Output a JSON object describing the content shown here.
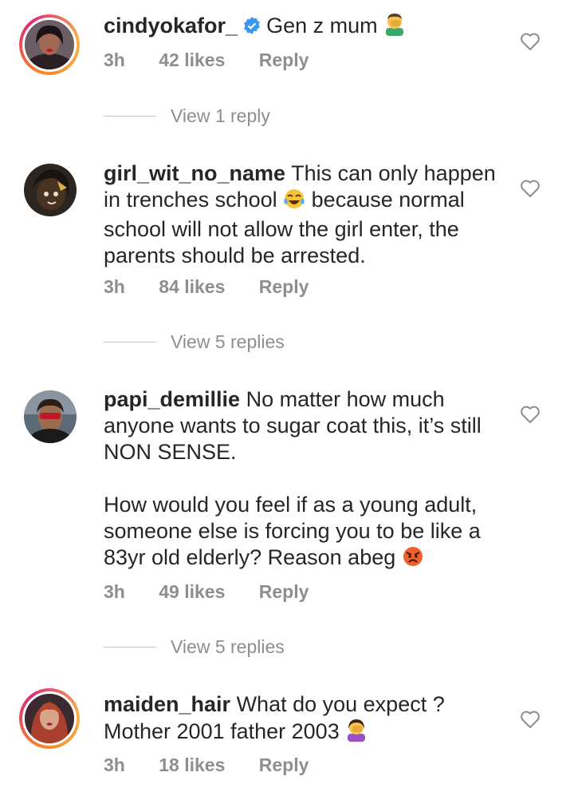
{
  "comments": [
    {
      "username": "cindyokafor_",
      "verified": true,
      "text": "Gen z mum",
      "time": "3h",
      "likes": "42 likes",
      "reply": "Reply",
      "view_replies": "View 1 reply",
      "emoji": "man-facepalming-emoji"
    },
    {
      "username": "girl_wit_no_name",
      "text_a": "This can only happen in trenches school",
      "text_b": "because normal school will not allow the girl enter, the parents should be arrested.",
      "time": "3h",
      "likes": "84 likes",
      "reply": "Reply",
      "view_replies": "View 5 replies",
      "emoji": "tears-of-joy-emoji"
    },
    {
      "username": "papi_demillie",
      "text_a": "No matter how much anyone wants to sugar coat this, it’s still NON SENSE.",
      "text_b": "How would you feel if as a young adult, someone else is forcing you to be like a 83yr old elderly? Reason abeg",
      "time": "3h",
      "likes": "49 likes",
      "reply": "Reply",
      "view_replies": "View 5 replies",
      "emoji": "angry-face-emoji"
    },
    {
      "username": "maiden_hair",
      "text": "What do you expect ? Mother 2001 father 2003",
      "time": "3h",
      "likes": "18 likes",
      "reply": "Reply",
      "emoji": "woman-facepalming-emoji"
    }
  ],
  "colors": {
    "text": "#262626",
    "muted": "#8e8e8e",
    "verified": "#3897f0",
    "ring_start": "#f58529",
    "ring_end": "#dd2a7b"
  }
}
